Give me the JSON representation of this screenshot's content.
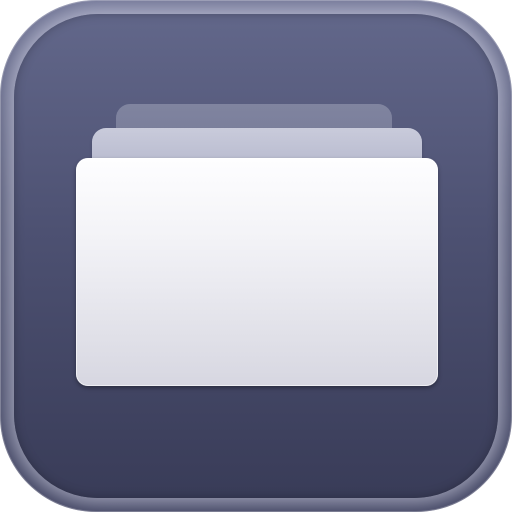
{
  "app_icon": {
    "icon": "folder-stack-icon",
    "colors": {
      "background_top": "#6f7394",
      "background_bottom": "#3f4260",
      "card_front": "#f3f3f7",
      "card_middle": "#b9bcd0",
      "card_back": "#858aa5"
    }
  }
}
